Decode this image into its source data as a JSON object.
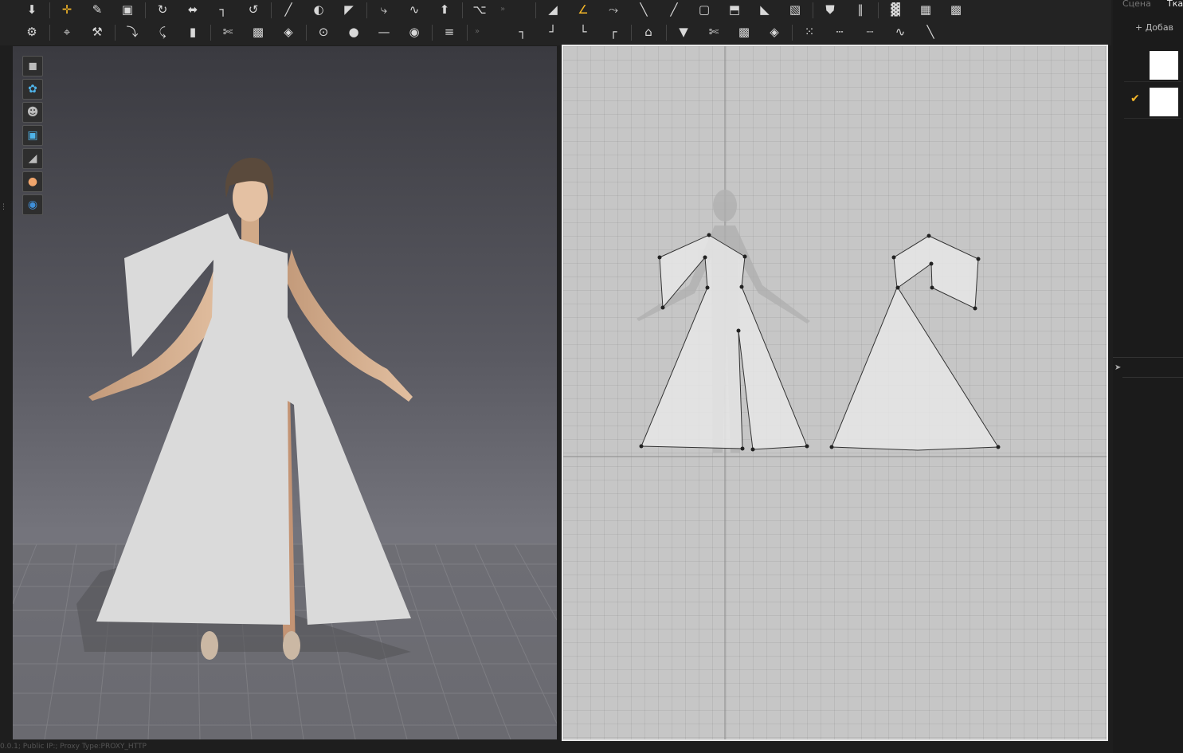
{
  "toolbar": {
    "row1_icons": [
      "download-icon",
      "move-cross-icon",
      "edit-pen-icon",
      "transform-box-icon",
      "edit-curve-icon",
      "point-move-icon",
      "segment-icon",
      "rotate-curve-icon",
      "line-tool-icon",
      "fold-icon",
      "garment-icon",
      "sew-edit-icon",
      "sew-free-icon",
      "sew-multi-icon",
      "shirt-icon",
      "collapse-icon",
      "triangle-tool-icon",
      "angle-tool-icon",
      "curve-tool-icon",
      "polyline-icon",
      "line-draw-icon",
      "rect-pattern-icon",
      "trace-icon",
      "fill-shape-icon",
      "internal-shape-icon",
      "shield-icon",
      "vertical-bars-icon",
      "graph-icon",
      "grid-a-icon",
      "grid-b-icon"
    ],
    "row2_icons": [
      "avatar-walk-icon",
      "pin-icon",
      "brush-pin-icon",
      "fold-arrange-icon",
      "tuck-icon",
      "sleeve-icon",
      "fabric-mod-icon",
      "checker-icon",
      "check-pattern-icon",
      "button-icon",
      "button-round-icon",
      "line-minus-icon",
      "lock-icon",
      "zipper-icon",
      "collapse-icon",
      "seam-a-icon",
      "seam-b-icon",
      "seam-c-icon",
      "seam-d-icon",
      "iron-icon",
      "tshirt-icon",
      "fabric-2-icon",
      "checker-2-icon",
      "check-pattern-2-icon",
      "selected-points-icon",
      "dashed-line-icon",
      "dotted-line-icon",
      "wave-line-icon",
      "stitch-line-icon"
    ]
  },
  "left_tools": [
    "garment-icon",
    "particle-icon",
    "avatar-icon",
    "texture-icon",
    "shading-icon",
    "skin-icon",
    "globe-icon"
  ],
  "right_panel": {
    "tabs": [
      "Сцена",
      "Ткан"
    ],
    "add_button_label": "+ Добав",
    "fabrics": [
      {
        "selected": false
      },
      {
        "selected": true
      }
    ]
  },
  "status_bar": "0.0.1; Public IP:; Proxy Type:PROXY_HTTP",
  "colors": {
    "accent": "#f5b728",
    "fabric": "#dadada"
  }
}
